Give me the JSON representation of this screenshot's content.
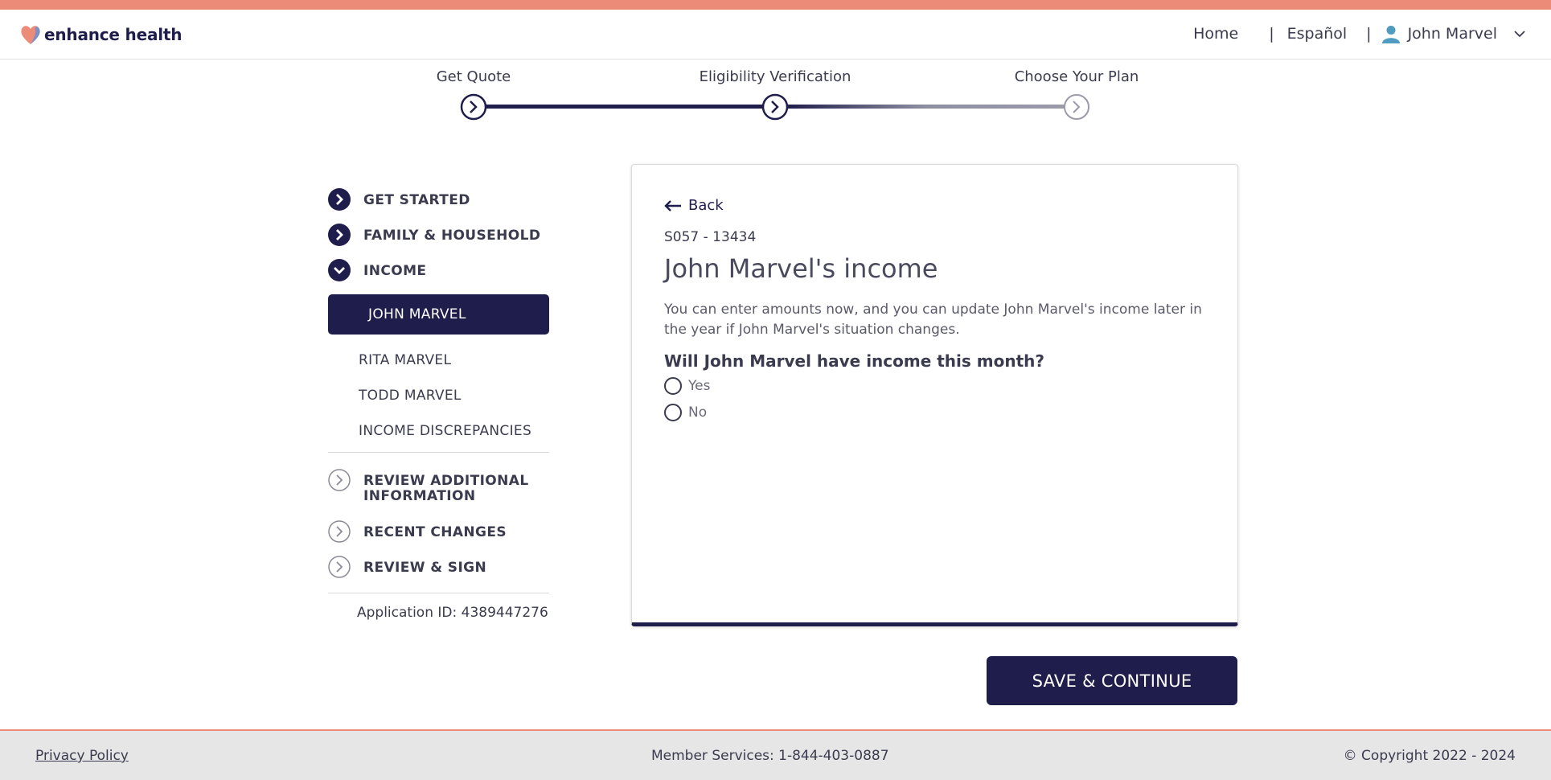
{
  "brand": {
    "name": "enhance health"
  },
  "nav": {
    "home": "Home",
    "language": "Español",
    "user_name": "John Marvel"
  },
  "steps": [
    {
      "label": "Get Quote"
    },
    {
      "label": "Eligibility Verification"
    },
    {
      "label": "Choose Your Plan"
    }
  ],
  "sidebar": {
    "get_started": "GET STARTED",
    "family": "FAMILY & HOUSEHOLD",
    "income": "INCOME",
    "income_members": [
      "JOHN MARVEL",
      "RITA MARVEL",
      "TODD MARVEL",
      "INCOME DISCREPANCIES"
    ],
    "review_additional_1": "REVIEW ADDITIONAL",
    "review_additional_2": "INFORMATION",
    "recent_changes": "RECENT CHANGES",
    "review_sign": "REVIEW & SIGN",
    "application_id": "Application ID: 4389447276"
  },
  "card": {
    "back": "Back",
    "code": "S057 - 13434",
    "title": "John Marvel's income",
    "description": "You can enter amounts now, and you can update John Marvel's income later in the year if John Marvel's situation changes.",
    "question": "Will John Marvel have income this month?",
    "options": [
      "Yes",
      "No"
    ]
  },
  "actions": {
    "save": "SAVE & CONTINUE"
  },
  "footer": {
    "privacy": "Privacy Policy",
    "member_services": "Member Services: 1-844-403-0887",
    "copyright": "© Copyright 2022 - 2024"
  },
  "colors": {
    "navy": "#1f1d4b",
    "coral": "#ec8c78",
    "footer_bg": "#e6e6e6"
  }
}
